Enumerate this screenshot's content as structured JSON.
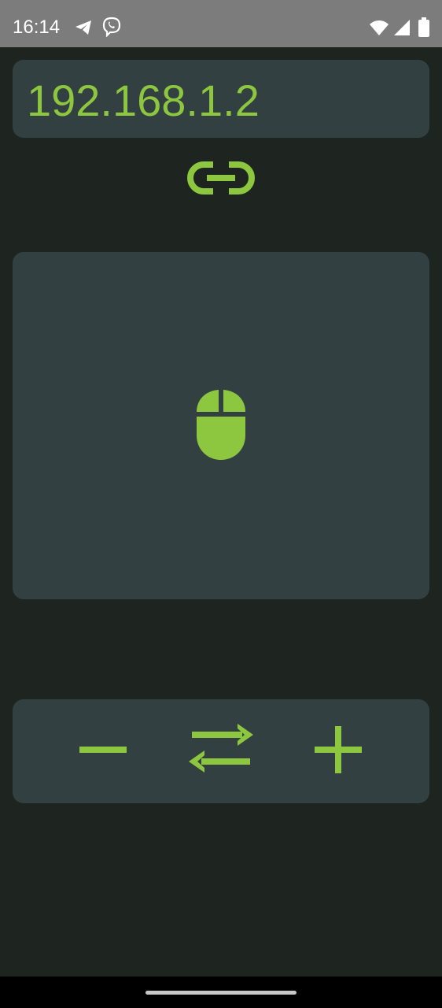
{
  "status_bar": {
    "time": "16:14",
    "icons": [
      "telegram-icon",
      "viber-icon",
      "wifi-icon",
      "cellular-signal-icon",
      "battery-icon"
    ]
  },
  "connection": {
    "ip_address": "192.168.1.2",
    "connect_icon": "link-icon"
  },
  "touchpad": {
    "icon": "mouse-icon"
  },
  "controls": {
    "buttons": [
      "minus-icon",
      "swap-arrows-icon",
      "plus-icon"
    ]
  },
  "colors": {
    "accent": "#8dc63f",
    "background": "#1e2521",
    "panel": "#334042",
    "status_bar": "#7c7c7c"
  }
}
